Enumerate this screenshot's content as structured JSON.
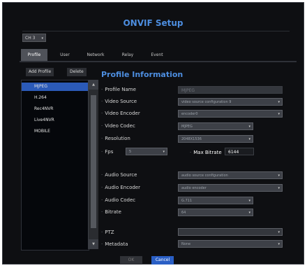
{
  "window": {
    "title": "ONVIF Setup"
  },
  "channel": {
    "value": "CH 3",
    "arrow": "▾"
  },
  "tabs": [
    {
      "label": "Profile"
    },
    {
      "label": "User"
    },
    {
      "label": "Network"
    },
    {
      "label": "Relay"
    },
    {
      "label": "Event"
    }
  ],
  "side": {
    "add_label": "Add Profile",
    "delete_label": "Delete"
  },
  "profiles": [
    "MJPEG",
    "H.264",
    "Rec4NVR",
    "Live4NVR",
    "MOBILE"
  ],
  "scroll": {
    "up": "▲",
    "down": "▼"
  },
  "info": {
    "title": "Profile Information",
    "profile_name_label": "Profile Name",
    "profile_name_value": "MJPEG",
    "video_source_label": "Video Source",
    "video_source_value": "video source configuration 9",
    "video_encoder_label": "Video Encoder",
    "video_encoder_value": "encoder0",
    "video_codec_label": "Video Codec",
    "video_codec_value": "MJPEG",
    "resolution_label": "Resolution",
    "resolution_value": "2048X1536",
    "fps_label": "Fps",
    "fps_value": "5",
    "max_bitrate_label": "Max Bitrate",
    "max_bitrate_value": "6144",
    "audio_source_label": "Audio Source",
    "audio_source_value": "audio source configuration",
    "audio_encoder_label": "Audio Encoder",
    "audio_encoder_value": "audio encoder",
    "audio_codec_label": "Audio Codec",
    "audio_codec_value": "G.711",
    "bitrate_label": "Bitrate",
    "bitrate_value": "64",
    "ptz_label": "PTZ",
    "ptz_value": "",
    "metadata_label": "Metadata",
    "metadata_value": "None"
  },
  "footer": {
    "ok_label": "OK",
    "cancel_label": "Cancel"
  },
  "colors": {
    "accent": "#4d8ee0",
    "selected": "#2b5ab8",
    "background": "#0e0f12"
  }
}
